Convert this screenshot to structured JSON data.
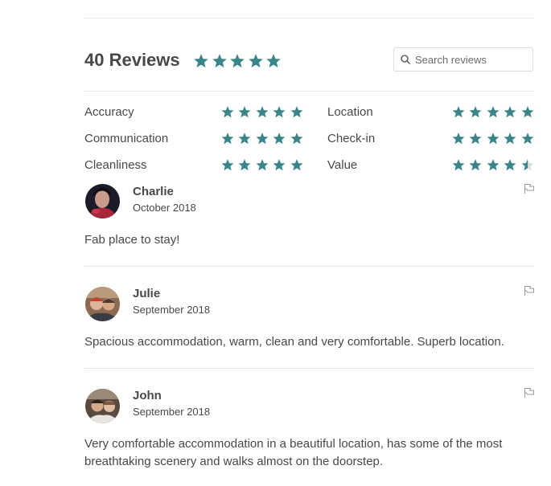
{
  "header": {
    "title": "40 Reviews",
    "overall_rating": 5,
    "search_placeholder": "Search reviews"
  },
  "colors": {
    "star": "#3a8589",
    "star_empty": "#d8d8d8",
    "text": "#484848",
    "divider": "#e6e6e6"
  },
  "categories": [
    {
      "label": "Accuracy",
      "rating": 5
    },
    {
      "label": "Communication",
      "rating": 5
    },
    {
      "label": "Cleanliness",
      "rating": 5
    },
    {
      "label": "Location",
      "rating": 5
    },
    {
      "label": "Check-in",
      "rating": 5
    },
    {
      "label": "Value",
      "rating": 4.5
    }
  ],
  "reviews": [
    {
      "name": "Charlie",
      "date": "October 2018",
      "text": "Fab place to stay!",
      "avatar": "avatar-photo"
    },
    {
      "name": "Julie",
      "date": "September 2018",
      "text": "Spacious accommodation, warm, clean and very comfortable. Superb location.",
      "avatar": "avatar-photo"
    },
    {
      "name": "John",
      "date": "September 2018",
      "text": "Very comfortable accommodation in a beautiful location, has some of the most breathtaking scenery and walks almost on the doorstep.",
      "avatar": "avatar-photo"
    }
  ],
  "icons": {
    "search": "search-icon",
    "flag": "flag-icon",
    "star": "star-icon"
  }
}
